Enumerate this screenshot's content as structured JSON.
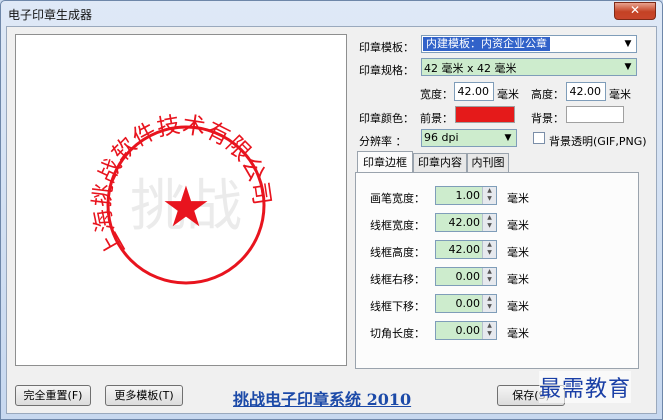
{
  "window": {
    "title": "电子印章生成器",
    "close_label": "✕"
  },
  "stamp": {
    "arc_text": "上海挑战软件技术有限公司",
    "star": "★",
    "watermark_text": "挑战",
    "color": "#e8141e"
  },
  "form": {
    "template_label": "印章模板：",
    "template_value": "内建模板：内资企业公章",
    "spec_label": "印章规格：",
    "spec_value": "42 毫米  x  42 毫米",
    "width_label": "宽度：",
    "width_value": "42.00",
    "width_unit": "毫米",
    "height_label": "高度：",
    "height_value": "42.00",
    "height_unit": "毫米",
    "color_label": "印章颜色：",
    "foreground_label": "前景：",
    "foreground_color": "#e51a1a",
    "background_label": "背景：",
    "background_color": "#ffffff",
    "resolution_label": "分辨率  ：",
    "resolution_value": "96 dpi",
    "transparent_label": "背景透明(GIF,PNG)"
  },
  "tabs": [
    {
      "label": "印章边框"
    },
    {
      "label": "印章内容"
    },
    {
      "label": "内刊图"
    }
  ],
  "border_fields": [
    {
      "label": "画笔宽度：",
      "value": "1.00",
      "unit": "毫米"
    },
    {
      "label": "线框宽度：",
      "value": "42.00",
      "unit": "毫米"
    },
    {
      "label": "线框高度：",
      "value": "42.00",
      "unit": "毫米"
    },
    {
      "label": "线框右移：",
      "value": "0.00",
      "unit": "毫米"
    },
    {
      "label": "线框下移：",
      "value": "0.00",
      "unit": "毫米"
    },
    {
      "label": "切角长度：",
      "value": "0.00",
      "unit": "毫米"
    }
  ],
  "footer": {
    "reset_label": "完全重置(F)",
    "more_templates_label": "更多模板(T)",
    "app_title": "挑战电子印章系统 2010",
    "save_label": "保存(S)"
  },
  "overlay": {
    "watermark": "最需教育"
  }
}
